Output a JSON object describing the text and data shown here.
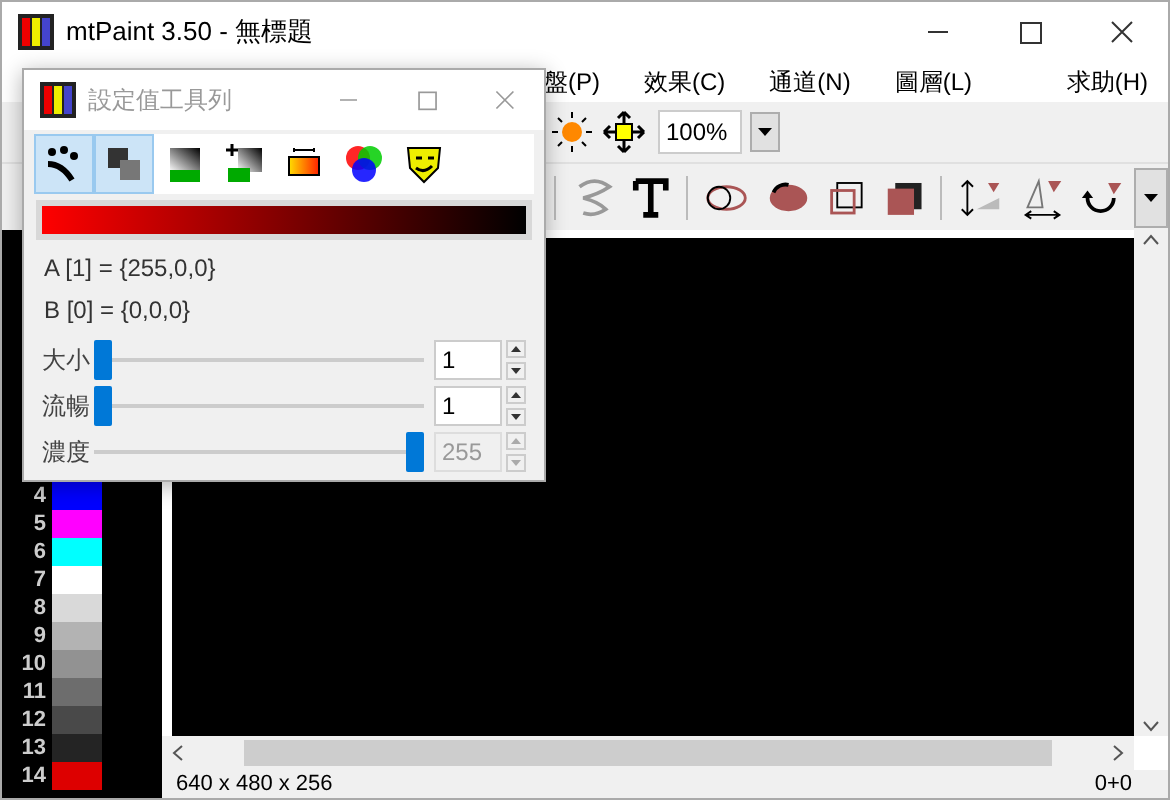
{
  "main_window": {
    "title": "mtPaint 3.50 - 無標題"
  },
  "menu": [
    {
      "label": "盤(P)"
    },
    {
      "label": "效果(C)"
    },
    {
      "label": "通道(N)"
    },
    {
      "label": "圖層(L)"
    },
    {
      "label": "求助(H)"
    }
  ],
  "zoom": {
    "value": "100%"
  },
  "palette": [
    {
      "index": "4",
      "color": "#0000ff"
    },
    {
      "index": "5",
      "color": "#ff00ff"
    },
    {
      "index": "6",
      "color": "#00ffff"
    },
    {
      "index": "7",
      "color": "#ffffff"
    },
    {
      "index": "8",
      "color": "#d9d9d9"
    },
    {
      "index": "9",
      "color": "#b3b3b3"
    },
    {
      "index": "10",
      "color": "#929292"
    },
    {
      "index": "11",
      "color": "#6d6d6d"
    },
    {
      "index": "12",
      "color": "#494949"
    },
    {
      "index": "13",
      "color": "#242424"
    },
    {
      "index": "14",
      "color": "#dd0000"
    }
  ],
  "status_bar": {
    "size": "640 x 480 x 256",
    "position": "0+0"
  },
  "dialog": {
    "title": "設定值工具列",
    "tools": [
      {
        "kind": "spray",
        "selected": true
      },
      {
        "kind": "opacity",
        "selected": true
      },
      {
        "kind": "gradient",
        "selected": false
      },
      {
        "kind": "gradient-plus",
        "selected": false
      },
      {
        "kind": "fill",
        "selected": false
      },
      {
        "kind": "colors",
        "selected": false
      },
      {
        "kind": "mask",
        "selected": false
      }
    ],
    "color_a": "A [1] = {255,0,0}",
    "color_b": "B [0] = {0,0,0}",
    "sliders": [
      {
        "label": "大小",
        "level": 0,
        "value": "1",
        "disabled": false
      },
      {
        "label": "流暢",
        "level": 0,
        "value": "1",
        "disabled": false
      },
      {
        "label": "濃度",
        "level": 1,
        "value": "255",
        "disabled": true
      }
    ]
  }
}
